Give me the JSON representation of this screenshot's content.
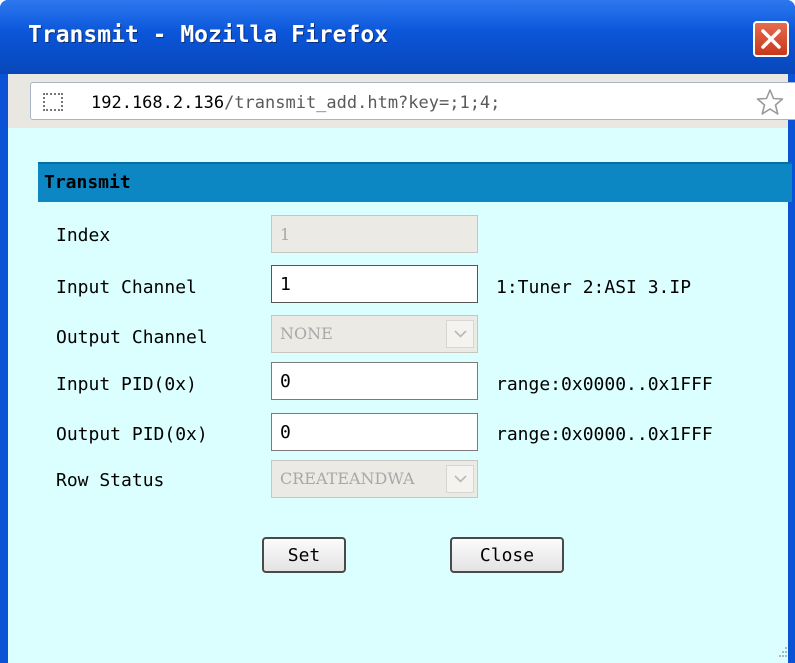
{
  "window": {
    "title": "Transmit - Mozilla Firefox"
  },
  "address_bar": {
    "url_host": "192.168.2.136",
    "url_path": "/transmit_add.htm?key=;1;4;"
  },
  "form": {
    "section_title": "Transmit",
    "rows": {
      "index": {
        "label": "Index",
        "value": "1"
      },
      "input_channel": {
        "label": "Input Channel",
        "value": "1",
        "hint": "1:Tuner 2:ASI 3.IP"
      },
      "output_channel": {
        "label": "Output Channel",
        "value": "NONE"
      },
      "input_pid": {
        "label": "Input PID(0x)",
        "value": "0",
        "hint": "range:0x0000..0x1FFF"
      },
      "output_pid": {
        "label": "Output PID(0x)",
        "value": "0",
        "hint": "range:0x0000..0x1FFF"
      },
      "row_status": {
        "label": "Row Status",
        "value": "CREATEANDWA"
      }
    },
    "buttons": {
      "set": "Set",
      "close": "Close"
    }
  },
  "colors": {
    "titlebar": "#0a55d8",
    "content_bg": "#dbffff",
    "section_header": "#0d86c4"
  },
  "icons": {
    "window_close": "close-x-icon",
    "site_identity": "page-icon",
    "bookmark": "star-icon",
    "resize": "resize-grip-icon"
  }
}
